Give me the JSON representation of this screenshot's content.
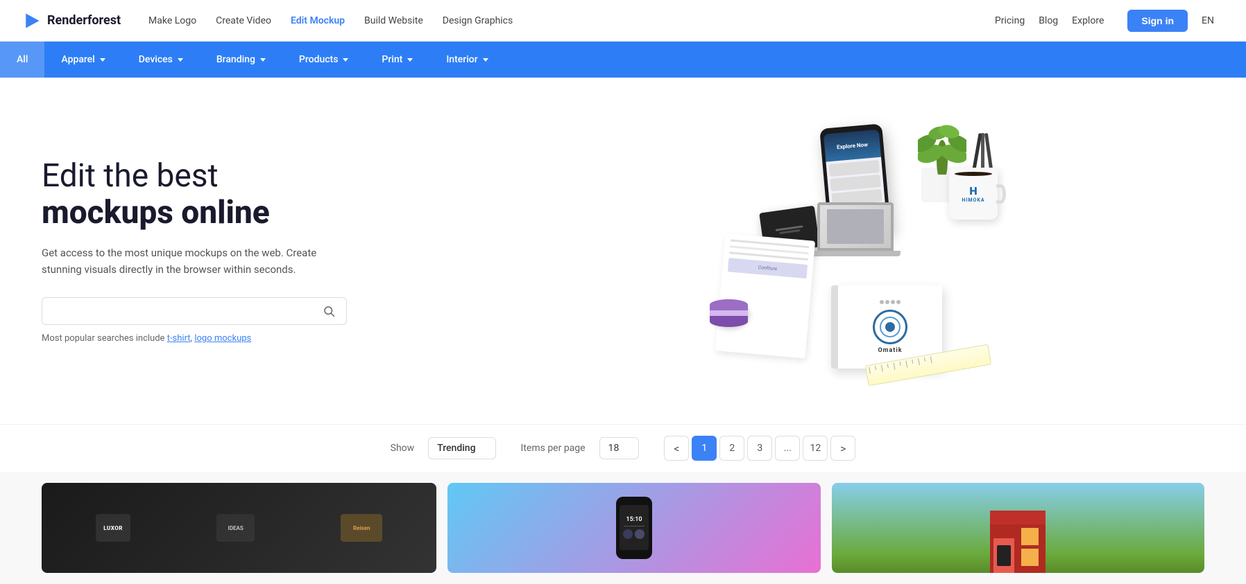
{
  "logo": {
    "name": "Renderforest",
    "tagline": "Renderforest"
  },
  "topNav": {
    "links": [
      {
        "id": "make-logo",
        "label": "Make Logo",
        "active": false
      },
      {
        "id": "create-video",
        "label": "Create Video",
        "active": false
      },
      {
        "id": "edit-mockup",
        "label": "Edit Mockup",
        "active": true
      },
      {
        "id": "build-website",
        "label": "Build Website",
        "active": false
      },
      {
        "id": "design-graphics",
        "label": "Design Graphics",
        "active": false
      }
    ],
    "rightLinks": [
      {
        "id": "pricing",
        "label": "Pricing"
      },
      {
        "id": "blog",
        "label": "Blog"
      },
      {
        "id": "explore",
        "label": "Explore"
      }
    ],
    "signIn": "Sign in",
    "language": "EN"
  },
  "categoryBar": {
    "categories": [
      {
        "id": "all",
        "label": "All",
        "hasDropdown": false,
        "active": true
      },
      {
        "id": "apparel",
        "label": "Apparel",
        "hasDropdown": true,
        "active": false
      },
      {
        "id": "devices",
        "label": "Devices",
        "hasDropdown": true,
        "active": false
      },
      {
        "id": "branding",
        "label": "Branding",
        "hasDropdown": true,
        "active": false
      },
      {
        "id": "products",
        "label": "Products",
        "hasDropdown": true,
        "active": false
      },
      {
        "id": "print",
        "label": "Print",
        "hasDropdown": true,
        "active": false
      },
      {
        "id": "interior",
        "label": "Interior",
        "hasDropdown": true,
        "active": false
      }
    ]
  },
  "hero": {
    "titleLine1": "Edit the best",
    "titleLine2": "mockups online",
    "subtitle": "Get access to the most unique mockups on the web. Create stunning visuals directly in the browser within seconds.",
    "searchPlaceholder": "",
    "popularText": "Most popular searches include",
    "popularLinks": [
      "t-shirt",
      "logo mockups"
    ]
  },
  "controls": {
    "showLabel": "Show",
    "sortLabel": "Trending",
    "itemsLabel": "Items per page",
    "itemsCount": "18",
    "pagination": {
      "pages": [
        "1",
        "2",
        "3",
        "...",
        "12"
      ],
      "activePage": "1",
      "prevLabel": "<",
      "nextLabel": ">"
    }
  },
  "cards": [
    {
      "id": "card-logos",
      "type": "dark",
      "labels": [
        "",
        "IDEAS",
        "Reisen"
      ]
    },
    {
      "id": "card-phone",
      "type": "gradient",
      "timeText": "15:10"
    },
    {
      "id": "card-street",
      "type": "street",
      "label": ""
    }
  ],
  "colors": {
    "primary": "#3b82f6",
    "navBlue": "#2d7ef6",
    "dark": "#1a1a2e",
    "activeNavLink": "#3b82f6"
  }
}
